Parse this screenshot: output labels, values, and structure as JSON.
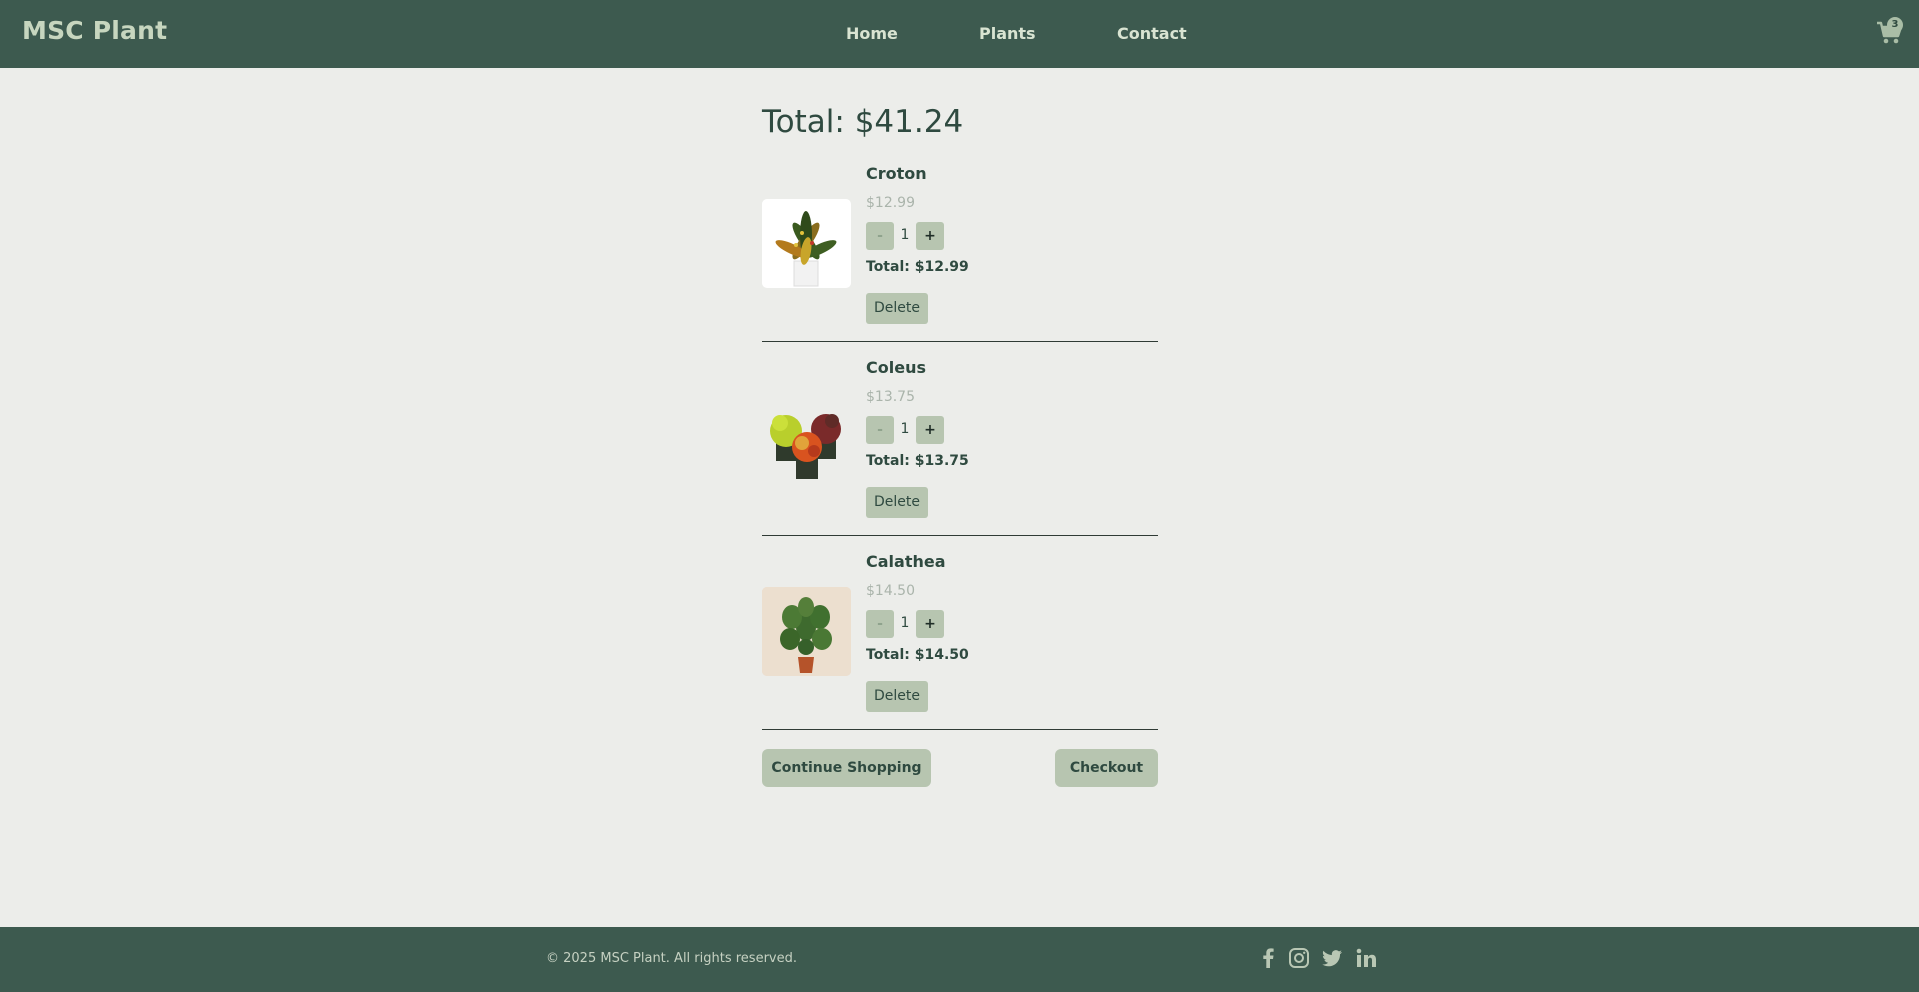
{
  "header": {
    "brand": "MSC Plant",
    "nav": [
      "Home",
      "Plants",
      "Contact"
    ],
    "cart_count": "3"
  },
  "cart": {
    "total_label": "Total: $41.24",
    "items": [
      {
        "name": "Croton",
        "price": "$12.99",
        "qty": "1",
        "total": "Total: $12.99",
        "minus": "-",
        "plus": "+",
        "delete": "Delete"
      },
      {
        "name": "Coleus",
        "price": "$13.75",
        "qty": "1",
        "total": "Total: $13.75",
        "minus": "-",
        "plus": "+",
        "delete": "Delete"
      },
      {
        "name": "Calathea",
        "price": "$14.50",
        "qty": "1",
        "total": "Total: $14.50",
        "minus": "-",
        "plus": "+",
        "delete": "Delete"
      }
    ],
    "continue_label": "Continue Shopping",
    "checkout_label": "Checkout"
  },
  "footer": {
    "copyright": "© 2025 MSC Plant. All rights reserved.",
    "social_icons": [
      "facebook-icon",
      "instagram-icon",
      "twitter-icon",
      "linkedin-icon"
    ]
  },
  "colors": {
    "header_bg": "#3d5a4f",
    "page_bg": "#ecedea",
    "button_bg": "#b7c5b0",
    "text_dark": "#2f4a40"
  }
}
